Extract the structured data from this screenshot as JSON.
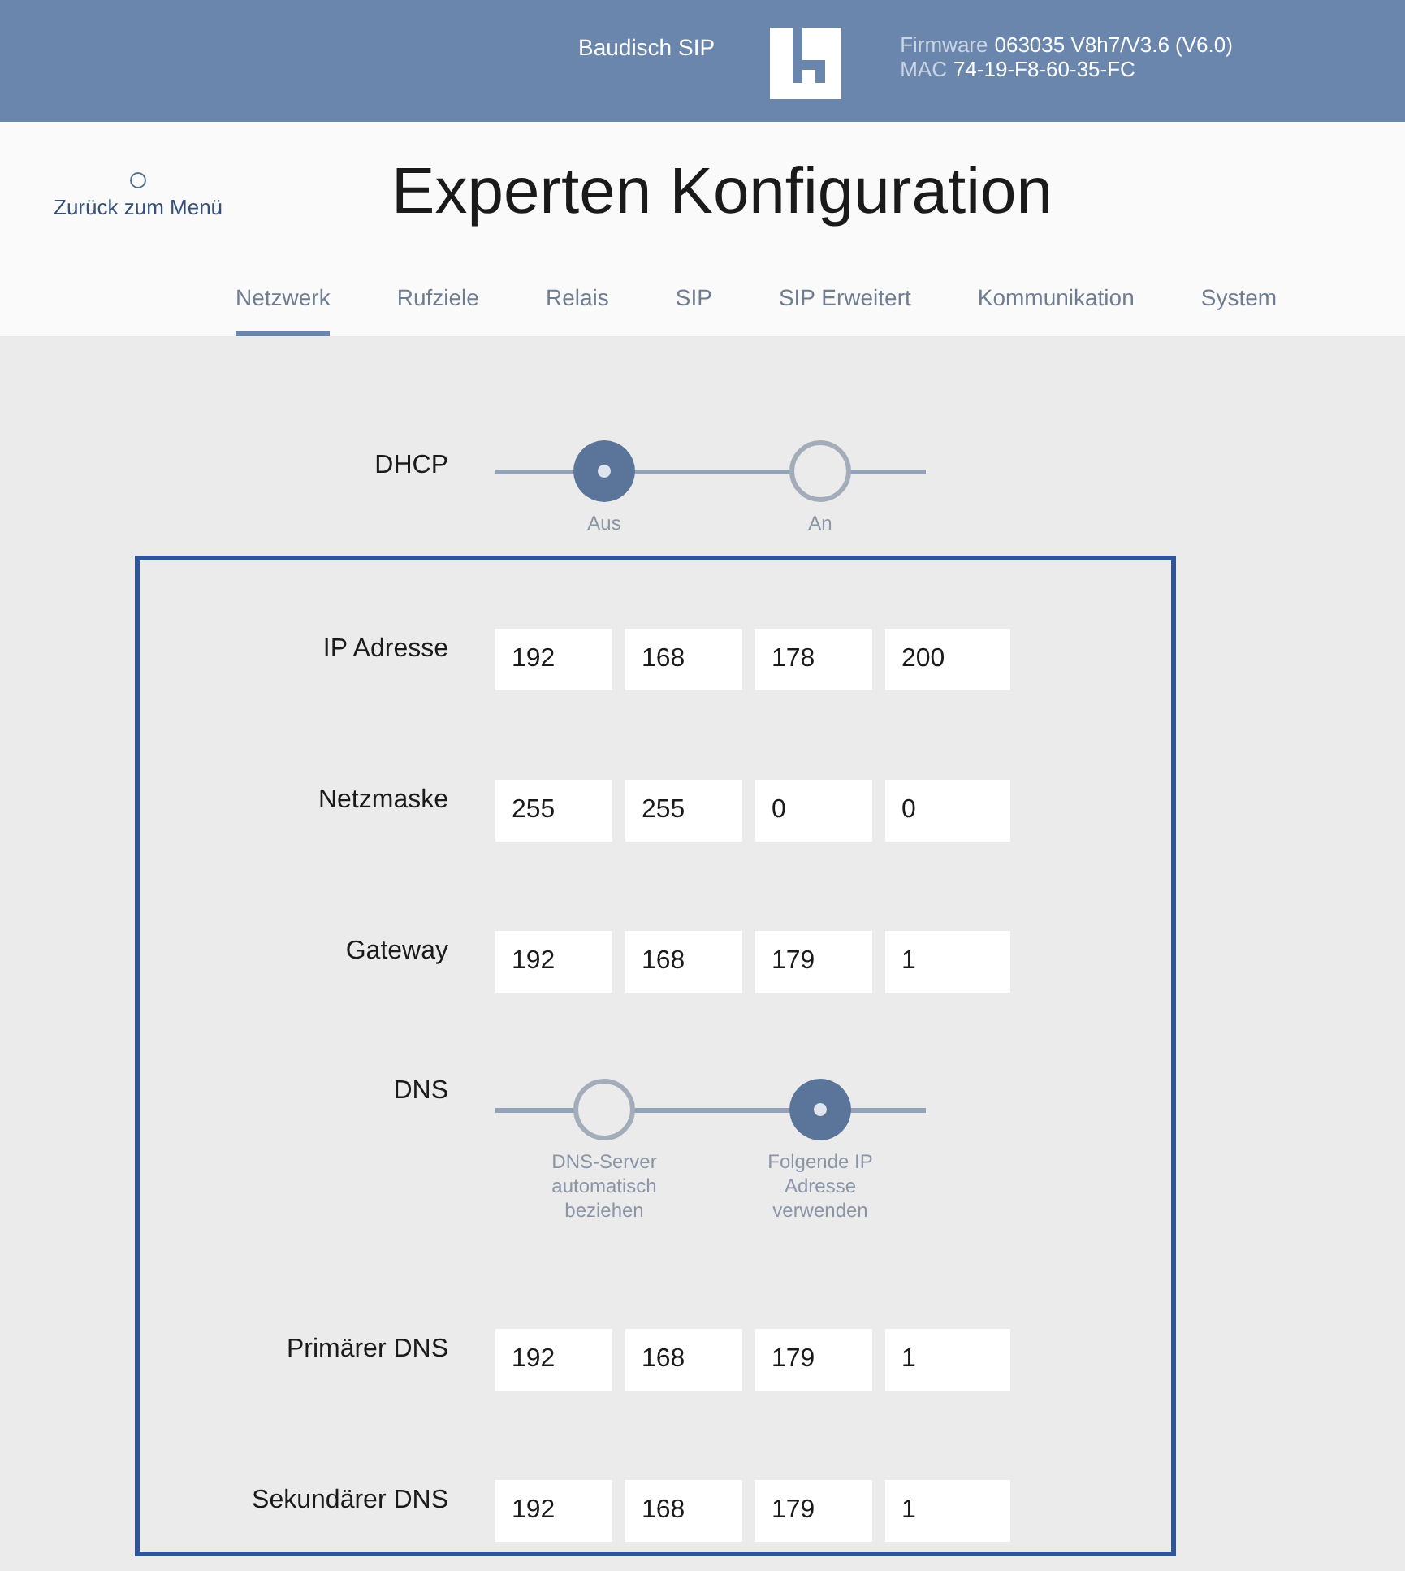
{
  "header": {
    "brand": "Baudisch SIP",
    "firmware_label": "Firmware",
    "firmware_value": "063035 V8h7/V3.6 (V6.0)",
    "mac_label": "MAC",
    "mac_value": "74-19-F8-60-35-FC"
  },
  "back_link": {
    "label": "Zurück zum Menü"
  },
  "title": "Experten Konfiguration",
  "tabs": [
    {
      "label": "Netzwerk",
      "selected": true
    },
    {
      "label": "Rufziele",
      "selected": false
    },
    {
      "label": "Relais",
      "selected": false
    },
    {
      "label": "SIP",
      "selected": false
    },
    {
      "label": "SIP Erweitert",
      "selected": false
    },
    {
      "label": "Kommunikation",
      "selected": false
    },
    {
      "label": "System",
      "selected": false
    }
  ],
  "dhcp": {
    "label": "DHCP",
    "options": [
      {
        "label": "Aus",
        "selected": true
      },
      {
        "label": "An",
        "selected": false
      }
    ]
  },
  "fields": [
    {
      "kind": "ip",
      "label": "IP Adresse",
      "octets": [
        "192",
        "168",
        "178",
        "200"
      ]
    },
    {
      "kind": "ip",
      "label": "Netzmaske",
      "octets": [
        "255",
        "255",
        "0",
        "0"
      ]
    },
    {
      "kind": "ip",
      "label": "Gateway",
      "octets": [
        "192",
        "168",
        "179",
        "1"
      ]
    },
    {
      "kind": "radio",
      "label": "DNS",
      "options": [
        {
          "label": "DNS-Server automatisch beziehen",
          "selected": false
        },
        {
          "label": "Folgende IP Adresse verwenden",
          "selected": true
        }
      ]
    },
    {
      "kind": "ip",
      "label": "Primärer DNS",
      "octets": [
        "192",
        "168",
        "179",
        "1"
      ]
    },
    {
      "kind": "ip",
      "label": "Sekundärer DNS",
      "octets": [
        "192",
        "168",
        "179",
        "1"
      ]
    }
  ]
}
